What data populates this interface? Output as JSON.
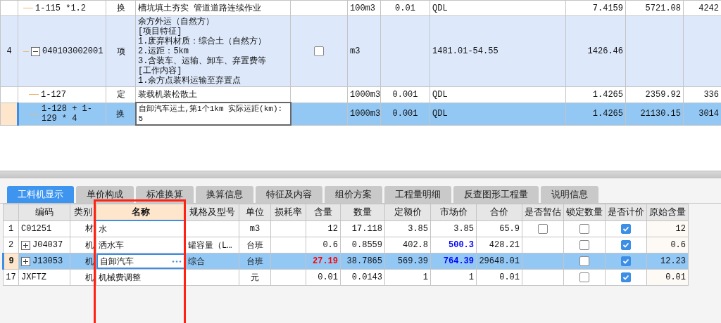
{
  "top_table": {
    "rows": [
      {
        "column_2": "1-115 *1.2",
        "column_3": "换",
        "column_4": "槽坑填土夯实 管道道路连续作业",
        "column_6": "100m3",
        "column_7": "0.01",
        "column_8": "QDL",
        "column_9": "7.4159",
        "column_10": "5721.08",
        "column_11": "4242",
        "selected": false
      },
      {
        "row_number": "4",
        "column_2": "040103002001",
        "expanded": true,
        "column_3": "项",
        "column_4": "余方外运（自然方）\n[项目特征]\n1.废弃料材质：综合土（自然方）\n2.运距：5km\n3.含装车、运输、卸车、弃置费等\n[工作内容]\n1.余方点装料运输至弃置点",
        "column_5_checked": false,
        "column_6": "m3",
        "column_7": "",
        "column_8": "1481.01-54.55",
        "column_9": "1426.46",
        "column_10": "",
        "column_11": "",
        "selected": false,
        "children": [
          {
            "column_2": "1-127",
            "column_3": "定",
            "column_4": "装载机装松散土",
            "column_6": "1000m3",
            "column_7": "0.001",
            "column_8": "QDL",
            "column_9": "1.4265",
            "column_10": "2359.92",
            "column_11": "336",
            "selected": false
          },
          {
            "column_2": "1-128 + 1-129 * 4",
            "column_3": "换",
            "column_4": "自卸汽车运土,第1个1km  实际运距(km):\n5",
            "column_6": "1000m3",
            "column_7": "0.001",
            "column_8": "QDL",
            "column_9": "1.4265",
            "column_10": "21130.15",
            "column_11": "3014",
            "selected": true
          }
        ]
      }
    ]
  },
  "tabs": [
    {
      "label": "工料机显示",
      "selected": true
    },
    {
      "label": "单价构成",
      "selected": false
    },
    {
      "label": "标准换算",
      "selected": false
    },
    {
      "label": "换算信息",
      "selected": false
    },
    {
      "label": "特征及内容",
      "selected": false
    },
    {
      "label": "组价方案",
      "selected": false
    },
    {
      "label": "工程量明细",
      "selected": false
    },
    {
      "label": "反查图形工程量",
      "selected": false
    },
    {
      "label": "说明信息",
      "selected": false
    }
  ],
  "grid": {
    "columns": [
      {
        "selected": false
      },
      {
        "label": "编码",
        "selected": false
      },
      {
        "label": "类别",
        "selected": false
      },
      {
        "label": "名称",
        "selected": true
      },
      {
        "label": "规格及型号",
        "selected": false
      },
      {
        "label": "单位",
        "selected": false
      },
      {
        "label": "损耗率",
        "selected": false
      },
      {
        "label": "含量",
        "selected": false
      },
      {
        "label": "数量",
        "selected": false
      },
      {
        "label": "定额价",
        "selected": false
      },
      {
        "label": "市场价",
        "selected": false
      },
      {
        "label": "合价",
        "selected": false
      },
      {
        "label": "是否暂估",
        "selected": false
      },
      {
        "label": "锁定数量",
        "selected": false
      },
      {
        "label": "是否计价",
        "selected": false
      },
      {
        "label": "原始含量",
        "selected": false
      }
    ],
    "rows": [
      {
        "number": "1",
        "code": "C01251",
        "category": "材",
        "name": "水",
        "spec": "",
        "unit": "m3",
        "loss": "",
        "content": "12",
        "content_modified": false,
        "quantity": "17.118",
        "quota_price": "3.85",
        "market_price": "3.85",
        "market_modified": false,
        "total": "65.9",
        "estimate_checked": false,
        "lock_checked": false,
        "priced_checked": true,
        "original": "12",
        "selected": false
      },
      {
        "number": "2",
        "code": "J04037",
        "expanded": false,
        "category": "机",
        "name": "洒水车",
        "spec": "罐容量（L…",
        "unit": "台班",
        "loss": "",
        "content": "0.6",
        "content_modified": false,
        "quantity": "0.8559",
        "quota_price": "402.8",
        "market_price": "500.3",
        "market_modified": true,
        "total": "428.21",
        "lock_checked": false,
        "priced_checked": true,
        "original": "0.6",
        "selected": false
      },
      {
        "number": "9",
        "code": "J13053",
        "expanded": false,
        "category": "机",
        "name": "自卸汽车",
        "spec": "综合",
        "unit": "台班",
        "loss": "",
        "content": "27.19",
        "content_modified": true,
        "quantity": "38.7865",
        "quota_price": "569.39",
        "market_price": "764.39",
        "market_modified": true,
        "total": "29648.01",
        "lock_checked": false,
        "priced_checked": true,
        "original": "12.23",
        "selected": true
      },
      {
        "number": "17",
        "code": "JXFTZ",
        "category": "机",
        "name": "机械费调整",
        "spec": "",
        "unit": "元",
        "loss": "",
        "content": "0.01",
        "content_modified": false,
        "quantity": "0.0143",
        "quota_price": "1",
        "market_price": "1",
        "market_modified": false,
        "total": "0.01",
        "lock_checked": false,
        "priced_checked": true,
        "original": "0.01",
        "selected": false
      }
    ]
  }
}
